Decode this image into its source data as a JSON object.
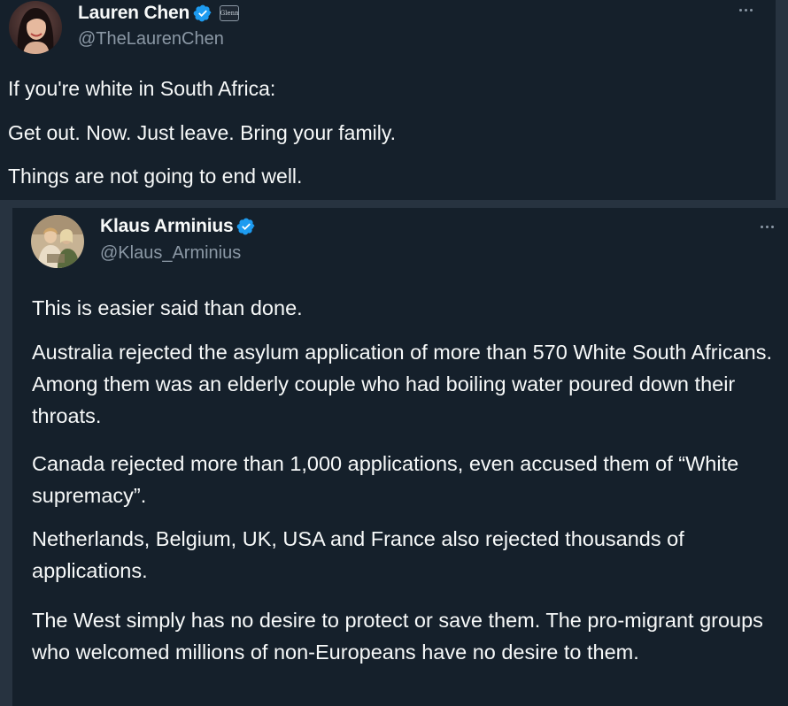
{
  "tweets": [
    {
      "author": {
        "name": "Lauren Chen",
        "handle": "@TheLaurenChen",
        "affiliate_badge_text": "Glenn"
      },
      "paragraphs": [
        "If you're white in South Africa:",
        "Get out. Now. Just leave. Bring your family.",
        "Things are not going to end well."
      ]
    },
    {
      "author": {
        "name": "Klaus Arminius",
        "handle": "@Klaus_Arminius"
      },
      "paragraphs": [
        "This is easier said than done.",
        "Australia rejected the asylum application of more than 570 White South Africans. Among them was an elderly couple who had boiling water poured down their throats.",
        "Canada rejected more than 1,000 applications, even accused them of “White supremacy”.",
        "Netherlands, Belgium, UK, USA and France also rejected thousands of applications.",
        "The West simply has no desire to protect or save them. The pro-migrant groups who welcomed millions of non-Europeans have no desire to them."
      ]
    }
  ],
  "icons": {
    "verified": "verified-badge-icon",
    "more": "more-options-icon"
  },
  "colors": {
    "background": "#15202b",
    "border": "#273340",
    "text_primary": "#f7f9f9",
    "text_secondary": "#8b98a5",
    "verified_blue": "#1d9bf0"
  }
}
